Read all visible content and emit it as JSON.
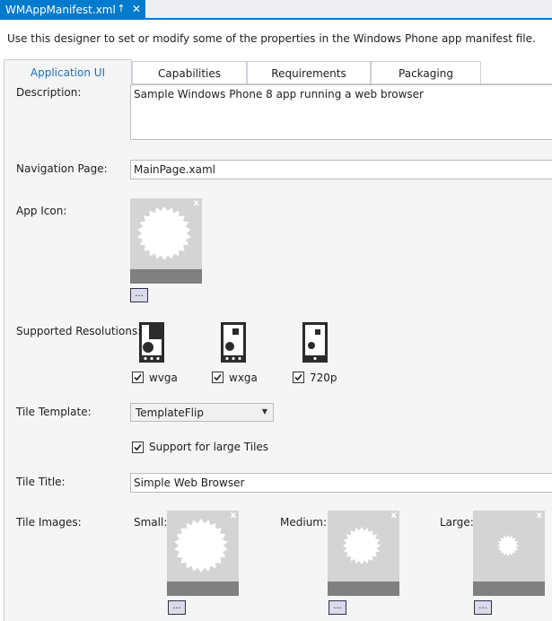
{
  "document_tab": {
    "title": "WMAppManifest.xml",
    "pin_glyph": "↑",
    "close_glyph": "✕"
  },
  "intro_text": "Use this designer to set or modify some of the properties in the Windows Phone app manifest file.",
  "tabs": [
    {
      "label": "Application UI",
      "active": true
    },
    {
      "label": "Capabilities",
      "active": false
    },
    {
      "label": "Requirements",
      "active": false
    },
    {
      "label": "Packaging",
      "active": false
    }
  ],
  "fields": {
    "description_label": "Description:",
    "description_value": "Sample Windows Phone 8 app running a web browser",
    "navigation_label": "Navigation Page:",
    "navigation_value": "MainPage.xaml",
    "app_icon_label": "App Icon:",
    "resolutions_label": "Supported Resolutions:",
    "tile_template_label": "Tile Template:",
    "tile_template_value": "TemplateFlip",
    "large_tiles_label": "Support for large Tiles",
    "tile_title_label": "Tile Title:",
    "tile_title_value": "Simple Web Browser",
    "tile_images_label": "Tile Images:"
  },
  "resolutions": [
    {
      "label": "wvga",
      "checked": true
    },
    {
      "label": "wxga",
      "checked": true
    },
    {
      "label": "720p",
      "checked": true
    }
  ],
  "large_tiles_checked": true,
  "tile_images": {
    "small_label": "Small:",
    "medium_label": "Medium:",
    "large_label": "Large:"
  },
  "buttons": {
    "browse_label": "..."
  },
  "image_close_glyph": "x",
  "dropdown_arrow": "▼",
  "colors": {
    "accent": "#007acc",
    "active_tab_text": "#1e6fc0",
    "panel_bg": "#f5f5f5",
    "image_bg": "#d4d4d4",
    "image_band": "#808080"
  }
}
